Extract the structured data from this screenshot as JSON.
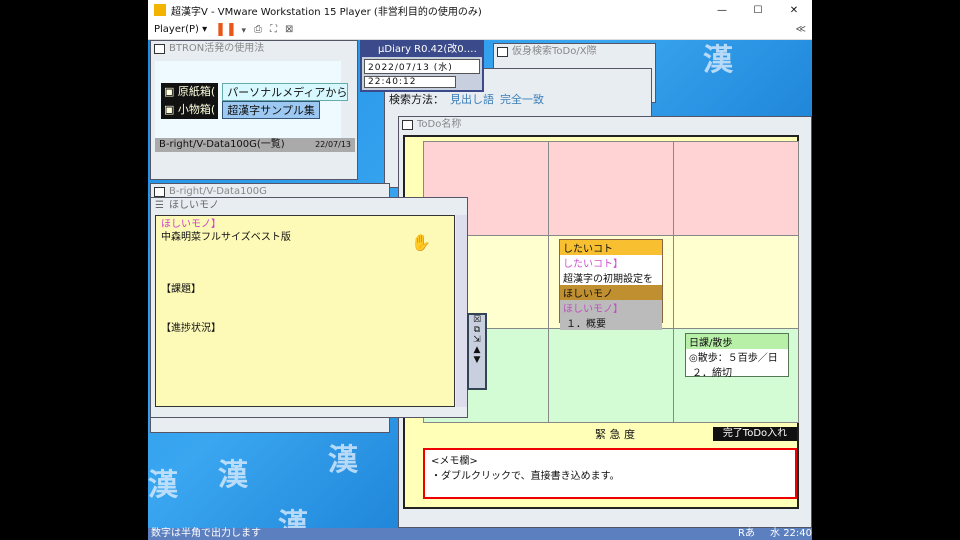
{
  "vmware": {
    "title": "超漢字V - VMware Workstation 15 Player (非営利目的の使用のみ)",
    "player_menu": "Player(P)",
    "minimize": "—",
    "maximize": "☐",
    "close": "✕",
    "collapse": "≪"
  },
  "btron_window": {
    "title": "BTRON活発の使用法",
    "items": [
      {
        "label": "原紙箱(",
        "value": "パーソナルメディアからの"
      },
      {
        "label": "小物箱(",
        "value": "超漢字サンプル集"
      }
    ],
    "footer": {
      "name": "B-right/V-Data100G(一覧)",
      "date": "22/07/13"
    }
  },
  "diary": {
    "title": "μDiary R0.42(改0.…",
    "date": "2022/07/13 (水)",
    "time": "22:40:12"
  },
  "back_window": {
    "title": "仮身検索ToDo/X際"
  },
  "search": {
    "label": "検索方法：",
    "opt1": "見出し語",
    "opt2": "完全一致"
  },
  "bright_window": {
    "title": "B-right/V-Data100G"
  },
  "hoshii": {
    "title": "ほしいモノ",
    "heading": "ほしいモノ】",
    "line1": "中森明菜フルサイズベスト版",
    "section1": "【課題】",
    "section2": "【進捗状況】"
  },
  "todo": {
    "title": "ToDo名称",
    "axis_label": "緊 急 度",
    "done_button": "完了ToDo入れ",
    "card1": {
      "header": "したいコト",
      "line1": "したいコト】",
      "line2": "超漢字の初期設定を"
    },
    "card2": {
      "header": "ほしいモノ",
      "line1": "ほしいモノ】",
      "line2": "１．概要"
    },
    "card3": {
      "header": "日課/散歩",
      "line1": "◎散歩：５百歩／日",
      "line2": "２．締切"
    },
    "memo": {
      "title": "<メモ欄>",
      "line1": "・ダブルクリックで、直接書き込めます。"
    },
    "colors": {
      "row1": "#ffd3d3",
      "row2": "#ffffd0",
      "row3": "#d4fcd4"
    }
  },
  "statusbar": {
    "message": "数字は半角で出力します",
    "ime": "Rあ",
    "day": "水",
    "clock": "22:40"
  }
}
